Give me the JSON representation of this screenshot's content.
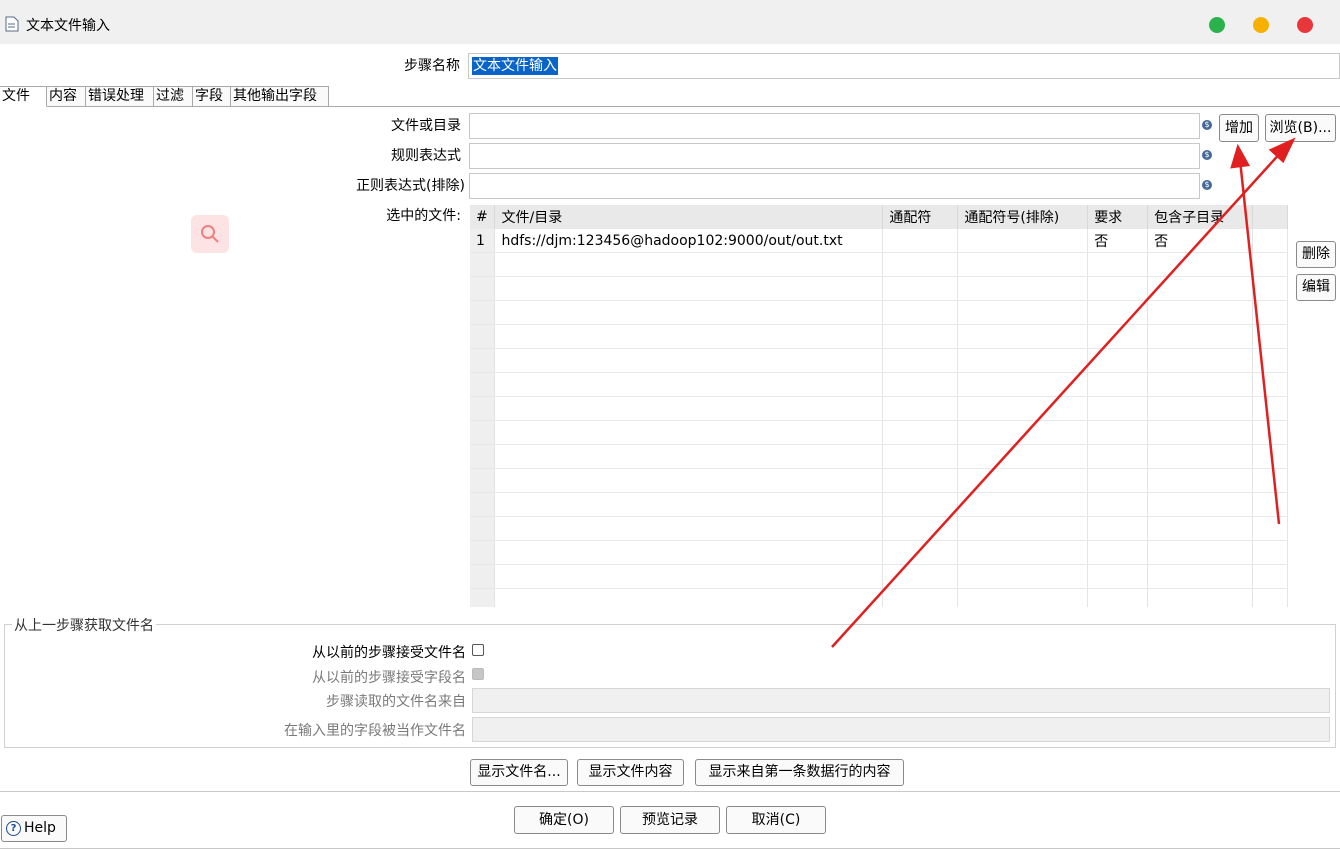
{
  "window": {
    "title": "文本文件输入",
    "controls": {
      "green": "#2bb24c",
      "yellow": "#f6b100",
      "red": "#e8373a"
    }
  },
  "step_name": {
    "label": "步骤名称",
    "value": "文本文件输入"
  },
  "tabs": [
    "文件",
    "内容",
    "错误处理",
    "过滤",
    "字段",
    "其他输出字段"
  ],
  "file_section": {
    "file_or_dir_label": "文件或目录",
    "regex_label": "规则表达式",
    "regex_exclude_label": "正则表达式(排除)",
    "selected_files_label": "选中的文件:",
    "add_button": "增加",
    "browse_button": "浏览(B)...",
    "delete_button": "删除",
    "edit_button": "编辑"
  },
  "grid": {
    "headers": [
      "#",
      "文件/目录",
      "通配符",
      "通配符号(排除)",
      "要求",
      "包含子目录"
    ],
    "rows": [
      [
        "1",
        "hdfs://djm:123456@hadoop102:9000/out/out.txt",
        "",
        "",
        "否",
        "否"
      ]
    ]
  },
  "prev_step_group": {
    "title": "从上一步骤获取文件名",
    "accept_filenames_label": "从以前的步骤接受文件名",
    "accept_fields_label": "从以前的步骤接受字段名",
    "step_read_label": "步骤读取的文件名来自",
    "field_as_filename_label": "在输入里的字段被当作文件名"
  },
  "action_buttons": {
    "show_filenames": "显示文件名...",
    "show_content": "显示文件内容",
    "show_first_row": "显示来自第一条数据行的内容"
  },
  "footer": {
    "help": "Help",
    "ok": "确定(O)",
    "preview": "预览记录",
    "cancel": "取消(C)"
  },
  "colors": {
    "selection": "#0a64c8",
    "arrow": "#e02020",
    "search_badge": "#fde3e3"
  }
}
